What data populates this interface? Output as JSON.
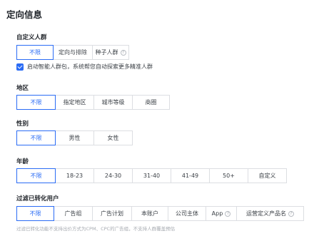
{
  "page_title": "定向信息",
  "custom_crowd": {
    "label": "自定义人群",
    "options": [
      "不限",
      "定向与排除",
      "种子人群"
    ],
    "checkbox_label": "启动智能人群包，系统帮您自动探索更多精准人群"
  },
  "region": {
    "label": "地区",
    "options": [
      "不限",
      "指定地区",
      "城市等级",
      "商圈"
    ]
  },
  "gender": {
    "label": "性别",
    "options": [
      "不限",
      "男性",
      "女性"
    ]
  },
  "age": {
    "label": "年龄",
    "options": [
      "不限",
      "18-23",
      "24-30",
      "31-40",
      "41-49",
      "50+",
      "自定义"
    ]
  },
  "filter_converted": {
    "label": "过滤已转化用户",
    "options": [
      "不限",
      "广告组",
      "广告计划",
      "本账户",
      "公司主体",
      "App",
      "运营定义产品名"
    ],
    "footnote": "过滤已转化功能不支持出价方式为CPM、CPC的广告组，不支持人群覆盖预估"
  },
  "icons": {
    "info": "info-circle-icon",
    "checkbox": "check-icon"
  },
  "colors": {
    "accent": "#2b6cf5",
    "border": "#dcdee2",
    "text": "#1f2329"
  }
}
